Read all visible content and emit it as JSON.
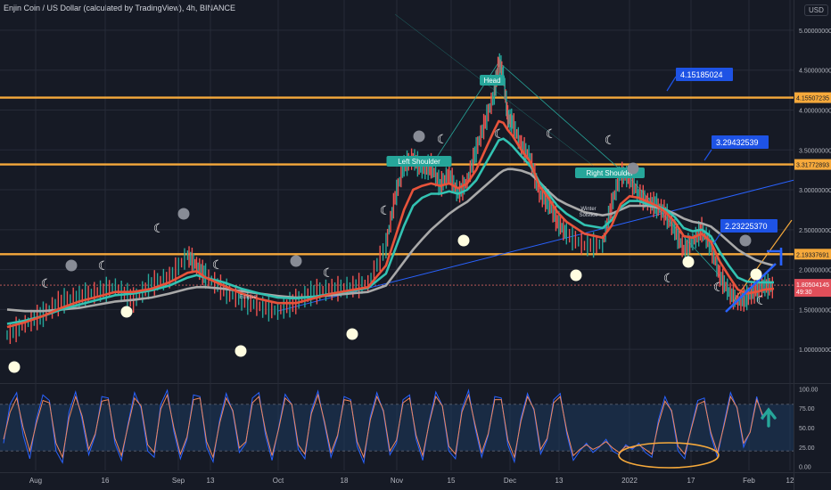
{
  "header": {
    "title": "Enjin Coin / US Dollar (calculated by TradingView), 4h, BINANCE",
    "currency": "USD"
  },
  "colors": {
    "background": "#161a25",
    "grid": "#262b38",
    "resistance": "#f6a93b",
    "price_line": "#d1605f",
    "ema_fast": "#e8533b",
    "ema_mid": "#33c2b2",
    "ema_slow": "#a9a9a9",
    "trendline": "#2962ff",
    "label_bg": "#1e53e5",
    "stoch_k": "#2962ff",
    "stoch_d": "#f0885f",
    "stoch_band": "#1e3a5f",
    "arrow_teal": "#26a69a",
    "current_price_bg": "#e04f5a",
    "pattern_label_bg": "#26a69a"
  },
  "chart_data": [
    {
      "type": "line",
      "title": "Enjin Coin / US Dollar (calculated by TradingView), 4h, BINANCE",
      "x_ticks": [
        "Aug",
        "16",
        "Sep",
        "13",
        "Oct",
        "18",
        "Nov",
        "15",
        "Dec",
        "13",
        "2022",
        "17",
        "Feb",
        "12"
      ],
      "y_ticks": [
        "5.00000000",
        "4.50000000",
        "4.00000000",
        "3.50000000",
        "3.00000000",
        "2.50000000",
        "2.00000000",
        "1.50000000",
        "1.00000000"
      ],
      "ylim": [
        0.6,
        5.2
      ],
      "x": [
        0,
        20,
        40,
        60,
        80,
        100,
        120,
        140,
        160,
        180,
        200,
        210,
        220,
        240,
        260,
        280,
        300,
        320,
        340,
        360,
        380,
        400,
        420,
        430,
        440,
        450,
        460,
        470,
        480,
        490,
        500,
        510,
        520,
        530,
        540,
        545,
        550,
        555,
        560,
        570,
        580,
        590,
        600,
        610,
        620,
        640,
        660,
        670,
        680,
        690,
        700,
        710,
        720,
        730,
        740,
        750,
        760,
        770,
        780,
        790,
        800,
        810,
        820,
        830,
        840,
        850
      ],
      "series": [
        {
          "key": "price",
          "values": [
            1.18,
            1.32,
            1.44,
            1.6,
            1.66,
            1.72,
            1.78,
            1.62,
            1.82,
            1.9,
            2.18,
            2.05,
            1.92,
            1.75,
            1.62,
            1.54,
            1.48,
            1.6,
            1.72,
            1.75,
            1.78,
            1.82,
            2.3,
            2.9,
            3.3,
            3.4,
            3.25,
            3.3,
            3.05,
            3.2,
            2.95,
            3.1,
            3.5,
            3.85,
            4.2,
            4.6,
            4.45,
            3.9,
            3.85,
            3.55,
            3.4,
            2.95,
            2.85,
            2.6,
            2.45,
            2.3,
            2.32,
            2.8,
            3.2,
            3.15,
            2.95,
            2.85,
            2.8,
            2.7,
            2.5,
            2.25,
            2.35,
            2.5,
            2.3,
            1.92,
            1.72,
            1.6,
            1.65,
            1.75,
            1.8,
            1.77
          ]
        },
        {
          "key": "ema_fast",
          "values": [
            1.28,
            1.34,
            1.42,
            1.52,
            1.6,
            1.66,
            1.72,
            1.72,
            1.76,
            1.84,
            1.96,
            1.98,
            1.9,
            1.8,
            1.7,
            1.63,
            1.58,
            1.58,
            1.64,
            1.7,
            1.74,
            1.78,
            2.05,
            2.4,
            2.75,
            3.0,
            3.05,
            3.08,
            3.05,
            3.08,
            3.02,
            3.08,
            3.25,
            3.5,
            3.75,
            3.86,
            3.84,
            3.75,
            3.68,
            3.5,
            3.35,
            3.05,
            2.9,
            2.72,
            2.6,
            2.45,
            2.4,
            2.55,
            2.82,
            2.92,
            2.9,
            2.85,
            2.8,
            2.72,
            2.6,
            2.42,
            2.4,
            2.45,
            2.35,
            2.1,
            1.92,
            1.75,
            1.7,
            1.72,
            1.75,
            1.76
          ]
        },
        {
          "key": "ema_mid",
          "values": [
            1.32,
            1.36,
            1.42,
            1.5,
            1.56,
            1.62,
            1.68,
            1.7,
            1.74,
            1.8,
            1.9,
            1.93,
            1.9,
            1.84,
            1.76,
            1.7,
            1.65,
            1.64,
            1.66,
            1.7,
            1.73,
            1.77,
            1.95,
            2.25,
            2.55,
            2.8,
            2.9,
            2.95,
            2.95,
            2.98,
            2.95,
            3.0,
            3.12,
            3.32,
            3.52,
            3.62,
            3.64,
            3.6,
            3.55,
            3.42,
            3.3,
            3.1,
            2.95,
            2.8,
            2.7,
            2.56,
            2.52,
            2.62,
            2.78,
            2.86,
            2.86,
            2.82,
            2.8,
            2.75,
            2.66,
            2.52,
            2.48,
            2.5,
            2.42,
            2.22,
            2.05,
            1.9,
            1.85,
            1.84,
            1.84,
            1.84
          ]
        },
        {
          "key": "ema_slow",
          "values": [
            1.5,
            1.48,
            1.48,
            1.5,
            1.52,
            1.56,
            1.6,
            1.62,
            1.65,
            1.7,
            1.76,
            1.78,
            1.78,
            1.76,
            1.73,
            1.7,
            1.67,
            1.65,
            1.66,
            1.68,
            1.7,
            1.72,
            1.8,
            1.95,
            2.1,
            2.25,
            2.38,
            2.5,
            2.6,
            2.7,
            2.78,
            2.85,
            2.95,
            3.05,
            3.15,
            3.2,
            3.24,
            3.26,
            3.26,
            3.24,
            3.2,
            3.1,
            2.98,
            2.88,
            2.82,
            2.72,
            2.68,
            2.7,
            2.75,
            2.8,
            2.8,
            2.8,
            2.78,
            2.75,
            2.7,
            2.64,
            2.6,
            2.58,
            2.54,
            2.45,
            2.35,
            2.25,
            2.18,
            2.12,
            2.08,
            2.05
          ]
        }
      ],
      "resistance_levels": [
        4.15507235,
        3.31772893,
        2.19337691
      ],
      "current_price": "1.80504145",
      "current_price_sub": "49:30"
    },
    {
      "type": "line",
      "y_ticks": [
        "100.00",
        "75.00",
        "50.00",
        "25.00",
        "0.00"
      ],
      "ylim": [
        -5,
        105
      ],
      "band": [
        20,
        80
      ],
      "series": [
        {
          "key": "stoch_k",
          "values": [
            30,
            80,
            95,
            40,
            10,
            60,
            92,
            85,
            20,
            5,
            70,
            96,
            60,
            15,
            40,
            90,
            88,
            30,
            8,
            55,
            95,
            75,
            20,
            12,
            80,
            98,
            45,
            10,
            35,
            92,
            90,
            25,
            6,
            60,
            94,
            70,
            18,
            30,
            88,
            95,
            40,
            8,
            50,
            93,
            80,
            22,
            10,
            72,
            97,
            55,
            12,
            38,
            90,
            86,
            26,
            5,
            64,
            95,
            70,
            15,
            30,
            86,
            92,
            35,
            8,
            58,
            96,
            78,
            20,
            10,
            74,
            98,
            50,
            12,
            40,
            90,
            88,
            28,
            6,
            62,
            94,
            72,
            16,
            34,
            86,
            94,
            42,
            8,
            20,
            30,
            18,
            25,
            35,
            20,
            15,
            28,
            22,
            30,
            18,
            12,
            60,
            90,
            70,
            20,
            10,
            50,
            85,
            88,
            40,
            12,
            55,
            95,
            75,
            25,
            45,
            90,
            60
          ]
        },
        {
          "key": "stoch_d",
          "values": [
            35,
            70,
            88,
            50,
            20,
            55,
            85,
            82,
            30,
            12,
            62,
            90,
            65,
            22,
            42,
            84,
            86,
            36,
            14,
            52,
            88,
            78,
            28,
            18,
            74,
            92,
            50,
            16,
            38,
            86,
            88,
            32,
            12,
            56,
            88,
            72,
            24,
            32,
            82,
            90,
            46,
            14,
            48,
            88,
            80,
            28,
            16,
            68,
            92,
            58,
            18,
            40,
            86,
            84,
            32,
            12,
            60,
            90,
            72,
            20,
            34,
            82,
            88,
            40,
            14,
            56,
            90,
            78,
            26,
            16,
            70,
            92,
            54,
            18,
            42,
            86,
            86,
            34,
            12,
            58,
            90,
            74,
            22,
            36,
            82,
            90,
            46,
            14,
            22,
            28,
            22,
            26,
            32,
            24,
            18,
            26,
            24,
            28,
            22,
            16,
            55,
            84,
            72,
            26,
            16,
            48,
            80,
            84,
            44,
            18,
            52,
            90,
            76,
            30,
            44,
            86,
            64
          ]
        }
      ]
    }
  ],
  "annotations": {
    "price_labels": [
      "4.15185024",
      "3.29432539",
      "2.23225370"
    ],
    "patterns": [
      "Head",
      "Left Shoulder",
      "Right Shoulder",
      "Bearish",
      "Neckline",
      "Winter Solstice"
    ],
    "eclipse": "Eclipse",
    "level_labels": [
      "4.15507235",
      "3.31772893",
      "2.19337691"
    ]
  }
}
